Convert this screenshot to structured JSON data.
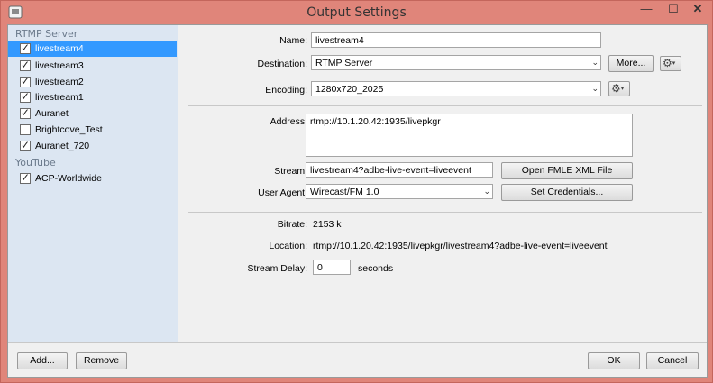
{
  "window": {
    "title": "Output Settings",
    "minimize_glyph": "—",
    "maximize_glyph": "☐",
    "close_glyph": "✕"
  },
  "sidebar": {
    "groups": [
      {
        "label": "RTMP Server",
        "items": [
          {
            "label": "livestream4",
            "checked": true,
            "selected": true
          },
          {
            "label": "livestream3",
            "checked": true,
            "selected": false
          },
          {
            "label": "livestream2",
            "checked": true,
            "selected": false
          },
          {
            "label": "livestream1",
            "checked": true,
            "selected": false
          },
          {
            "label": "Auranet",
            "checked": true,
            "selected": false
          },
          {
            "label": "Brightcove_Test",
            "checked": false,
            "selected": false
          },
          {
            "label": "Auranet_720",
            "checked": true,
            "selected": false
          }
        ]
      },
      {
        "label": "YouTube",
        "items": [
          {
            "label": "ACP-Worldwide",
            "checked": true,
            "selected": false
          }
        ]
      }
    ],
    "check_glyph": "✓"
  },
  "form": {
    "name_label": "Name:",
    "name_value": "livestream4",
    "destination_label": "Destination:",
    "destination_value": "RTMP Server",
    "more_button": "More...",
    "encoding_label": "Encoding:",
    "encoding_value": "1280x720_2025",
    "address_label": "Address:",
    "address_value": "rtmp://10.1.20.42:1935/livepkgr",
    "stream_label": "Stream:",
    "stream_value": "livestream4?adbe-live-event=liveevent",
    "open_fmle_button": "Open FMLE XML File",
    "user_agent_label": "User Agent:",
    "user_agent_value": "Wirecast/FM 1.0",
    "set_credentials_button": "Set Credentials...",
    "bitrate_label": "Bitrate:",
    "bitrate_value": "2153 k",
    "location_label": "Location:",
    "location_value": "rtmp://10.1.20.42:1935/livepkgr/livestream4?adbe-live-event=liveevent",
    "stream_delay_label": "Stream Delay:",
    "stream_delay_value": "0",
    "stream_delay_unit": "seconds",
    "gear_glyph": "⚙",
    "caret_glyph": "▾",
    "combo_arrow_glyph": "⌄"
  },
  "footer": {
    "add_button": "Add...",
    "remove_button": "Remove",
    "ok_button": "OK",
    "cancel_button": "Cancel"
  },
  "colors": {
    "window_frame": "#e0857a",
    "selection": "#3399ff",
    "sidebar_bg": "#dce6f2",
    "group_label": "#6b7a8c"
  },
  "icons": [
    "app-icon",
    "checkbox-check-icon",
    "gear-icon",
    "dropdown-arrow-icon"
  ]
}
